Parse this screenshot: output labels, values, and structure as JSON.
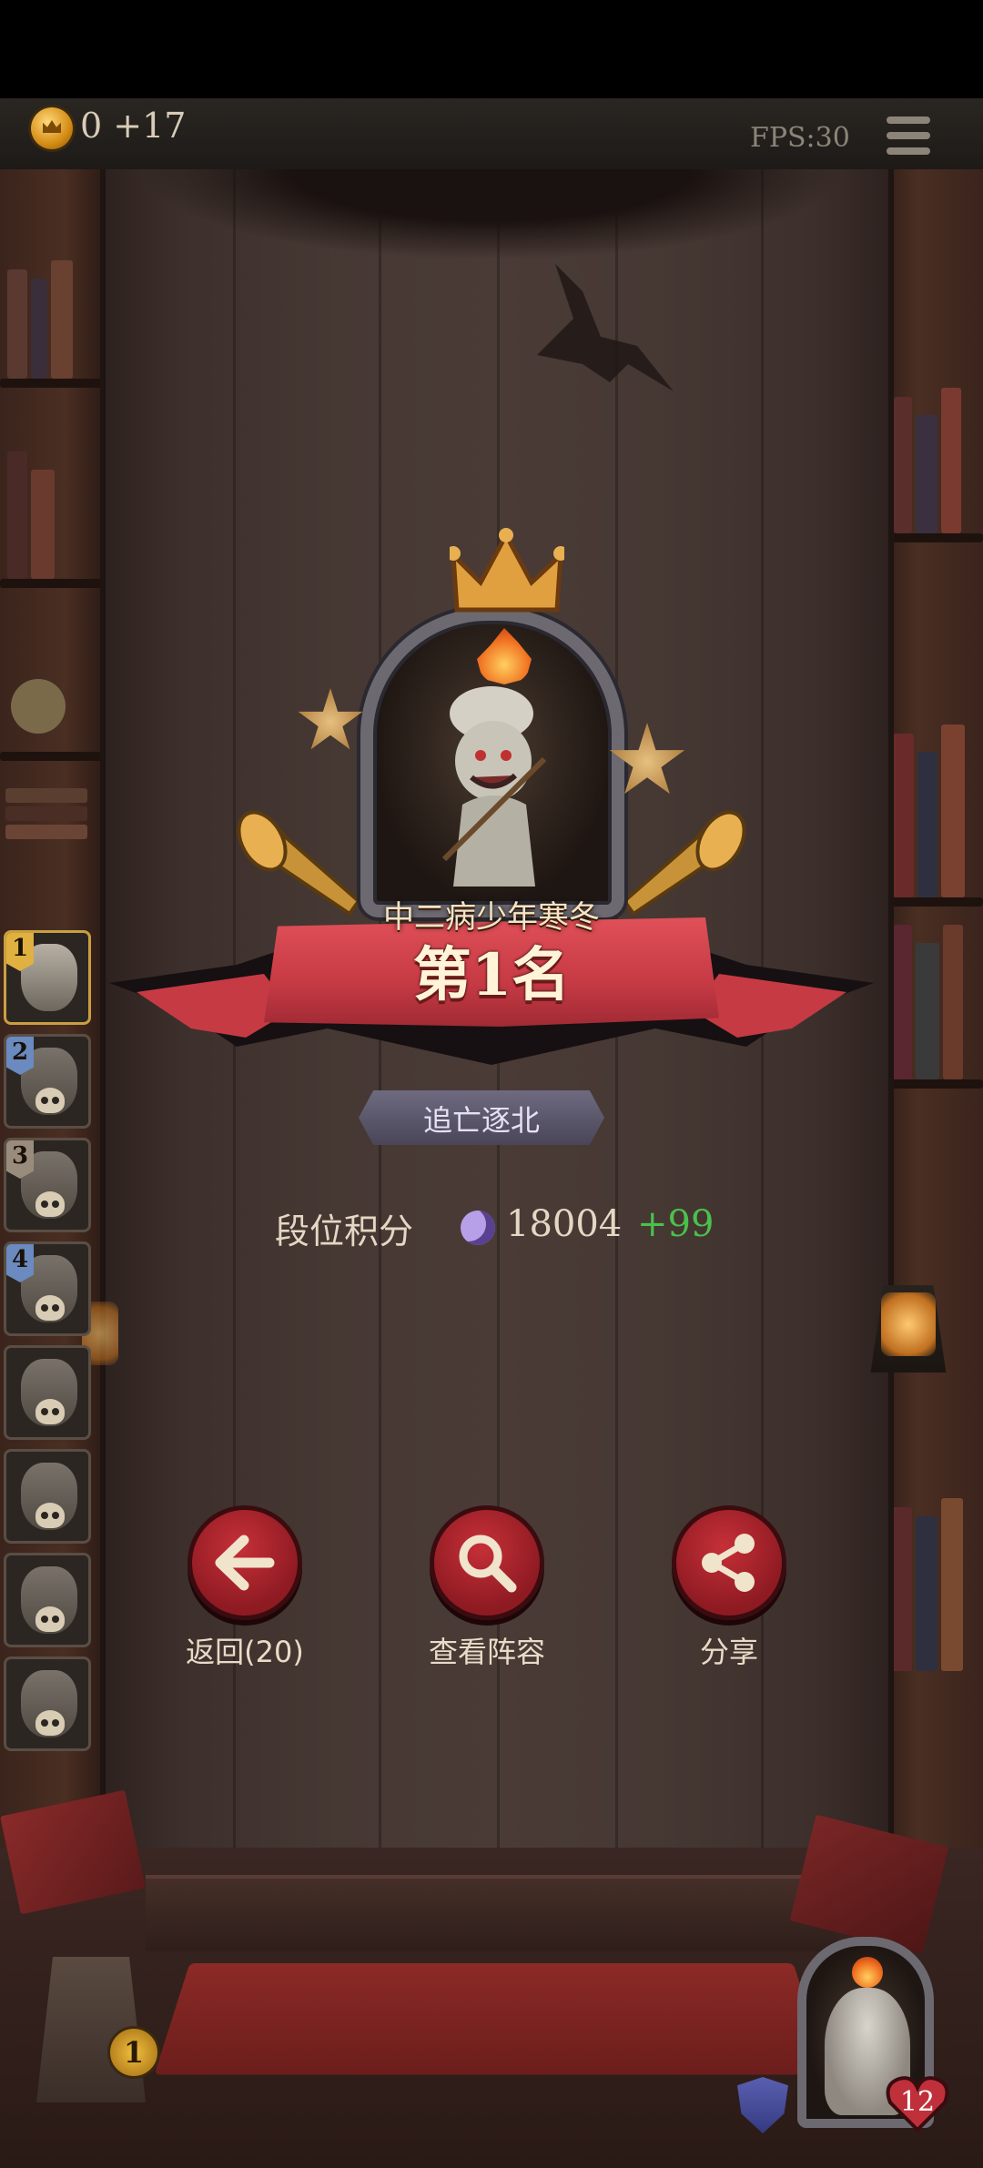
{
  "top_bar": {
    "coin_text": "0 +17",
    "fps_text": "FPS:30",
    "menu_icon": "hamburger-menu-icon"
  },
  "players": [
    {
      "rank": "1",
      "flag_color": "#e0b040",
      "avatar_icon": "chef-character-avatar"
    },
    {
      "rank": "2",
      "flag_color": "#6a8ac0",
      "avatar_icon": "shadow-character-avatar"
    },
    {
      "rank": "3",
      "flag_color": "#9a8c7c",
      "avatar_icon": "hat-character-avatar"
    },
    {
      "rank": "4",
      "flag_color": "#6a8ac0",
      "avatar_icon": "blonde-character-avatar"
    },
    {
      "rank": "",
      "flag_color": "",
      "avatar_icon": "bunny-character-avatar"
    },
    {
      "rank": "",
      "flag_color": "",
      "avatar_icon": "noble-character-avatar"
    },
    {
      "rank": "",
      "flag_color": "",
      "avatar_icon": "cat-character-avatar"
    },
    {
      "rank": "",
      "flag_color": "",
      "avatar_icon": "robot-character-avatar"
    }
  ],
  "result": {
    "player_name": "中二病少年寒冬",
    "rank_label": "第1名",
    "title_plate": "追亡逐北",
    "score_label": "段位积分",
    "score_value": "18004",
    "score_delta": "+99"
  },
  "actions": {
    "back_label": "返回(20)",
    "lineup_label": "查看阵容",
    "share_label": "分享"
  },
  "bottom": {
    "lock_level": "1",
    "heart_count": "12"
  },
  "colors": {
    "accent_red": "#c63038",
    "banner_red": "#e05058",
    "gain_green": "#4cc04c",
    "gold": "#e0b040"
  }
}
